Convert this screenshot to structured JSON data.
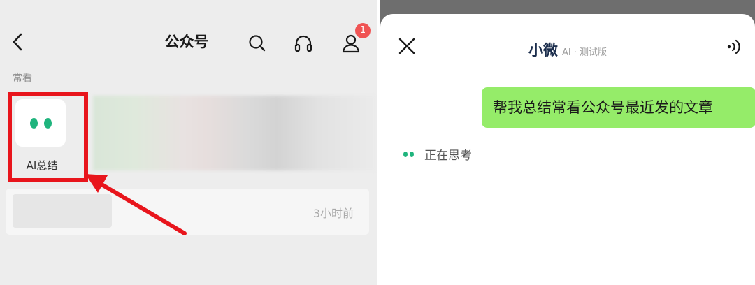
{
  "left_screen": {
    "header": {
      "back_icon": "chevron-left-icon",
      "title": "公众号",
      "search_icon": "search-icon",
      "headset_icon": "headset-icon",
      "contact_icon": "person-icon",
      "notification_count": "1"
    },
    "section_label": "常看",
    "ai_summary_tile": {
      "label": "AI总结",
      "icon": "two-dots-icon",
      "dot_color": "#1fb47d"
    },
    "highlight_color": "#e8151c",
    "article": {
      "time": "3小时前"
    }
  },
  "right_screen": {
    "header": {
      "close_icon": "close-icon",
      "title": "小微",
      "subtitle": "AI · 测试版",
      "voice_icon": "voice-wave-icon"
    },
    "messages": [
      {
        "role": "user",
        "text": "帮我总结常看公众号最近发的文章",
        "bubble_color": "#95ec69"
      }
    ],
    "status": {
      "text": "正在思考",
      "icon": "two-dots-icon"
    }
  }
}
